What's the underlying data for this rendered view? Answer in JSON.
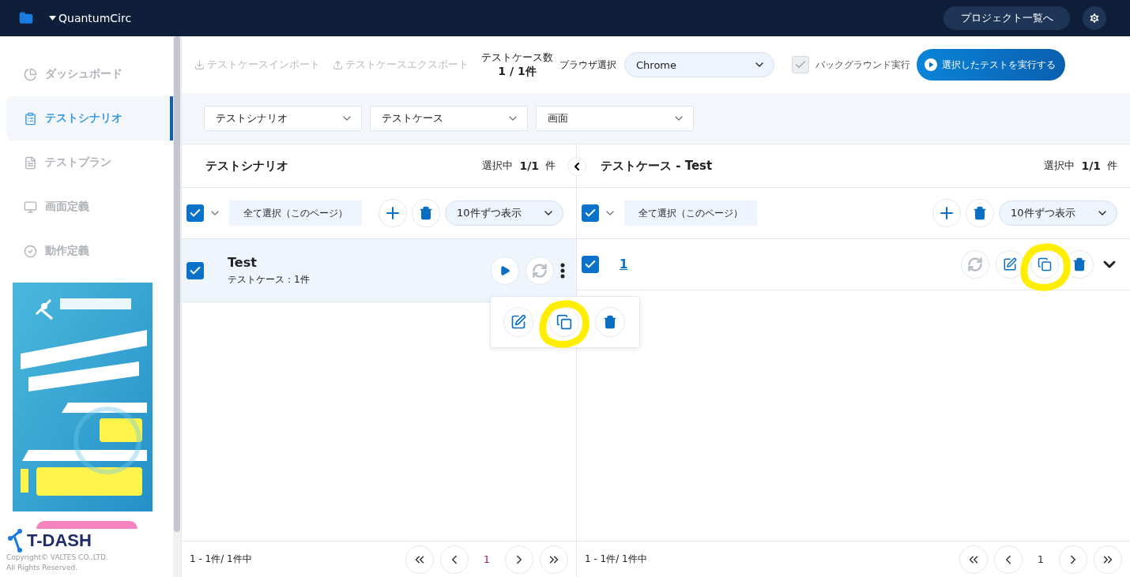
{
  "header": {
    "project": "QuantumCirc",
    "projects_button": "プロジェクト一覧へ"
  },
  "sidebar": {
    "items": [
      {
        "label": "ダッシュボード",
        "selected": false
      },
      {
        "label": "テストシナリオ",
        "selected": true
      },
      {
        "label": "テストプラン",
        "selected": false
      },
      {
        "label": "画面定義",
        "selected": false
      },
      {
        "label": "動作定義",
        "selected": false
      }
    ],
    "ad": {
      "kind": "picture"
    },
    "logo": "T-DASH",
    "copyright": [
      "Copyright© VALTES CO.,LTD.",
      "All Rights Reserved."
    ]
  },
  "toolbar": {
    "import": "テストケースインポート",
    "export": "テストケースエクスポート",
    "count_label": "テストケース数",
    "count": "1 / 1件",
    "browser_label": "ブラウザ選択",
    "browser": "Chrome",
    "background": {
      "label": "バックグラウンド実行",
      "checked": true,
      "disabled": true
    },
    "run_button": "選択したテストを実行する"
  },
  "filters": [
    "テストシナリオ",
    "テストケース",
    "画面"
  ],
  "scenario_panel": {
    "title": "テストシナリオ",
    "selected_label": "選択中",
    "selected_count": "1/1",
    "unit": "件",
    "select_all": {
      "label": "全て選択（このページ）",
      "checked": true
    },
    "page_size": "10件ずつ表示",
    "rows": [
      {
        "title": "Test",
        "subtitle": "テストケース：1件",
        "checked": true,
        "selected": true,
        "menu_open": true,
        "copy_highlighted": true
      }
    ],
    "footer": {
      "range": "1 - 1件/ 1件中",
      "page": "1"
    }
  },
  "case_panel": {
    "title": "テストケース - Test",
    "selected_label": "選択中",
    "selected_count": "1/1",
    "unit": "件",
    "select_all": {
      "label": "全て選択（このページ）",
      "checked": true
    },
    "page_size": "10件ずつ表示",
    "rows": [
      {
        "label": "1",
        "checked": true,
        "copy_highlighted": true
      }
    ],
    "footer": {
      "range": "1 - 1件/ 1件中",
      "page": "1"
    }
  }
}
